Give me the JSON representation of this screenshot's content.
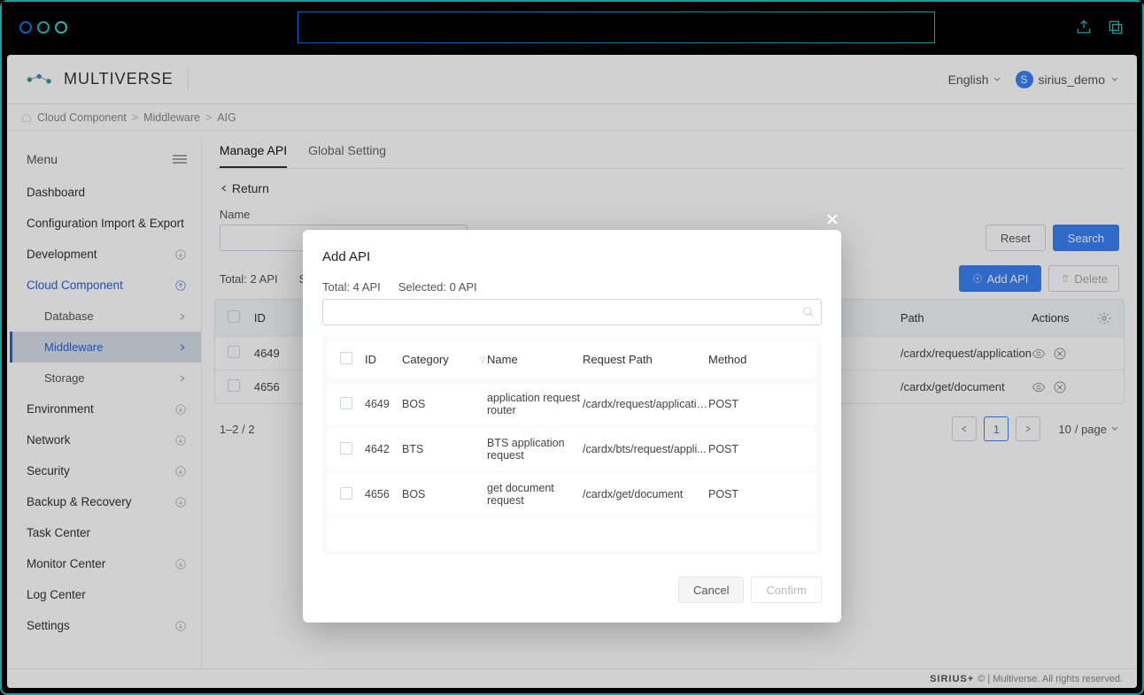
{
  "top": {
    "share_icon": "share",
    "copy_icon": "copy"
  },
  "header": {
    "brand": "MULTIVERSE",
    "language": "English",
    "avatar_letter": "S",
    "username": "sirius_demo"
  },
  "breadcrumb": [
    "Cloud Component",
    "Middleware",
    "AIG"
  ],
  "sidebar": {
    "title": "Menu",
    "items": [
      {
        "label": "Dashboard",
        "expandable": false
      },
      {
        "label": "Configuration Import & Export",
        "expandable": false
      },
      {
        "label": "Development",
        "expandable": true
      },
      {
        "label": "Cloud Component",
        "expandable": true,
        "active": true,
        "children": [
          {
            "label": "Database"
          },
          {
            "label": "Middleware",
            "selected": true
          },
          {
            "label": "Storage"
          }
        ]
      },
      {
        "label": "Environment",
        "expandable": true
      },
      {
        "label": "Network",
        "expandable": true
      },
      {
        "label": "Security",
        "expandable": true
      },
      {
        "label": "Backup & Recovery",
        "expandable": true
      },
      {
        "label": "Task Center",
        "expandable": false
      },
      {
        "label": "Monitor Center",
        "expandable": true
      },
      {
        "label": "Log Center",
        "expandable": false
      },
      {
        "label": "Settings",
        "expandable": true
      }
    ]
  },
  "tabs": {
    "manage": "Manage API",
    "global": "Global Setting"
  },
  "return_label": "Return",
  "filter": {
    "name_label": "Name",
    "reset": "Reset",
    "search": "Search"
  },
  "table": {
    "total": "Total: 2 API",
    "selected": "Sele",
    "add_btn": "Add API",
    "delete_btn": "Delete",
    "headers": {
      "id": "ID",
      "path": "Path",
      "actions": "Actions"
    },
    "rows": [
      {
        "id": "4649",
        "path": "/cardx/request/application"
      },
      {
        "id": "4656",
        "path": "/cardx/get/document"
      }
    ]
  },
  "pagination": {
    "range": "1–2 / 2",
    "page": "1",
    "size": "10",
    "per": "/ page"
  },
  "modal": {
    "title": "Add API",
    "total": "Total: 4 API",
    "selected": "Selected: 0 API",
    "headers": {
      "id": "ID",
      "category": "Category",
      "name": "Name",
      "path": "Request Path",
      "method": "Method"
    },
    "rows": [
      {
        "id": "4649",
        "category": "BOS",
        "name": "application request router",
        "path": "/cardx/request/application",
        "method": "POST"
      },
      {
        "id": "4642",
        "category": "BTS",
        "name": "BTS application request",
        "path": "/cardx/bts/request/appli...",
        "method": "POST"
      },
      {
        "id": "4656",
        "category": "BOS",
        "name": "get document request",
        "path": "/cardx/get/document",
        "method": "POST"
      }
    ],
    "cancel": "Cancel",
    "confirm": "Confirm"
  },
  "footer": {
    "brand": "SIRIUS+",
    "copyright": "© | Multiverse. All rights reserved."
  }
}
